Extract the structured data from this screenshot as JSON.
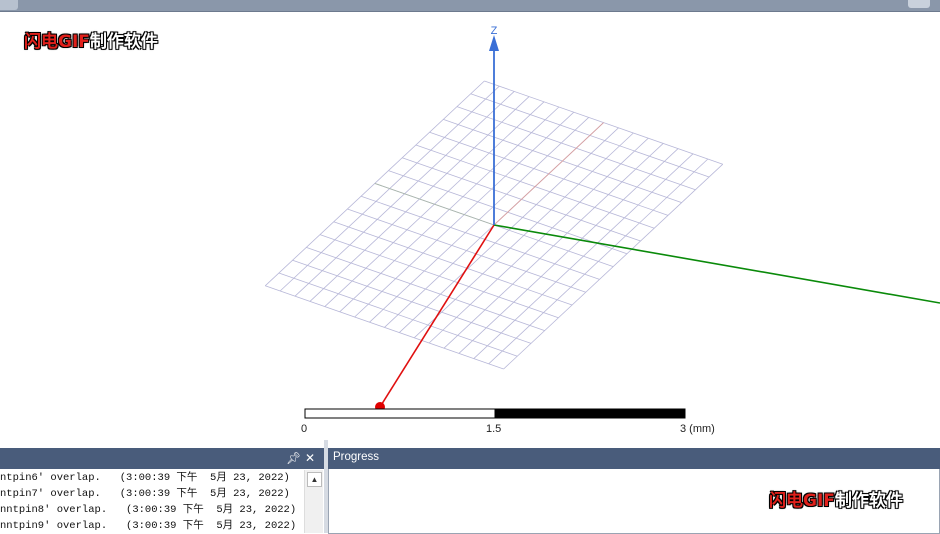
{
  "axis": {
    "z_label": "Z",
    "colors": {
      "x": "#e01010",
      "y": "#0a8a0a",
      "z": "#3a6fd6",
      "grid": "#b7b7d8",
      "origin_marker": "#e00000"
    }
  },
  "scale_bar": {
    "labels": [
      "0",
      "1.5",
      "3 (mm)"
    ]
  },
  "watermark": {
    "red_part": "闪电GIF",
    "white_part": "制作软件"
  },
  "message_panel": {
    "pin_icon": "pin-icon",
    "close_icon": "close-icon",
    "messages": [
      "ntpin6' overlap.   (3:00:39 下午  5月 23, 2022)",
      "ntpin7' overlap.   (3:00:39 下午  5月 23, 2022)",
      "nntpin8' overlap.   (3:00:39 下午  5月 23, 2022)",
      "nntpin9' overlap.   (3:00:39 下午  5月 23, 2022)"
    ]
  },
  "progress_panel": {
    "title": "Progress"
  }
}
